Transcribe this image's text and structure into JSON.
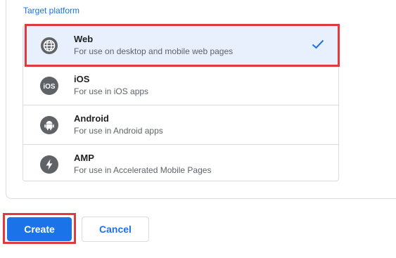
{
  "section": {
    "label": "Target platform"
  },
  "options": [
    {
      "icon": "globe-icon",
      "title": "Web",
      "subtitle": "For use on desktop and mobile web pages",
      "selected": true
    },
    {
      "icon": "ios-icon",
      "title": "iOS",
      "subtitle": "For use in iOS apps",
      "selected": false
    },
    {
      "icon": "android-icon",
      "title": "Android",
      "subtitle": "For use in Android apps",
      "selected": false
    },
    {
      "icon": "amp-icon",
      "title": "AMP",
      "subtitle": "For use in Accelerated Mobile Pages",
      "selected": false
    }
  ],
  "ios_icon_text": "iOS",
  "actions": {
    "create_label": "Create",
    "cancel_label": "Cancel"
  },
  "colors": {
    "accent": "#1a73e8",
    "selected_bg": "#e8f0fe",
    "annotation": "#e03a3e",
    "icon_gray": "#5f6368"
  }
}
